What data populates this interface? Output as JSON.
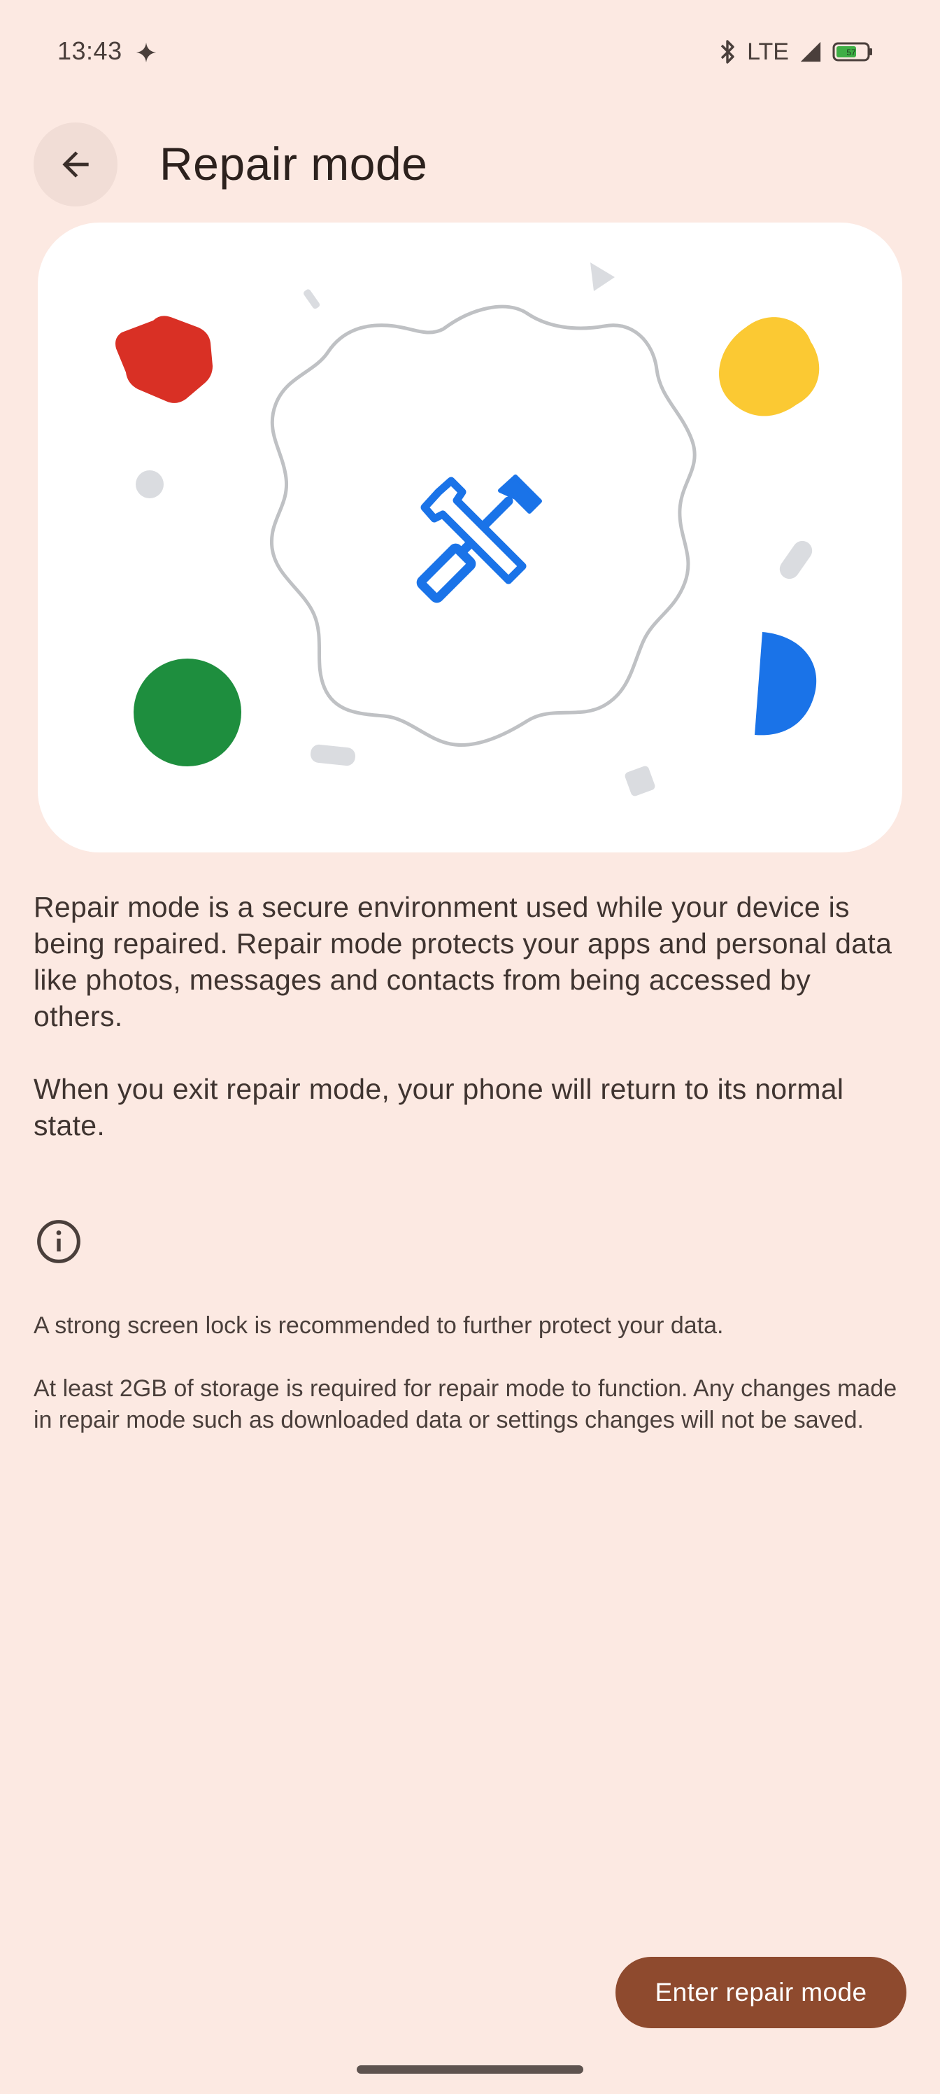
{
  "status_bar": {
    "time": "13:43",
    "network": "LTE",
    "battery_level": "57",
    "icons": [
      "sparkle-icon",
      "bluetooth-icon",
      "signal-icon",
      "battery-icon"
    ]
  },
  "header": {
    "back_icon": "arrow-back-icon",
    "title": "Repair mode"
  },
  "illustration": {
    "center_icon": "repair-tools-icon",
    "accent": "#1a73e8",
    "shape_colors": {
      "red": "#d93025",
      "yellow": "#fbc933",
      "green": "#1e8e3e",
      "blue": "#1a73e8",
      "gray": "#dadce0"
    }
  },
  "content": {
    "paragraph_1": "Repair mode is a secure environment used while your device is being repaired. Repair mode protects your apps and personal data like photos, messages and contacts from being accessed by others.",
    "paragraph_2": "When you exit repair mode, your phone will return to its normal state.",
    "info_icon": "info-icon",
    "note_1": "A strong screen lock is recommended to further protect your data.",
    "note_2": "At least 2GB of storage is required for repair mode to function. Any changes made in repair mode such as downloaded data or settings changes will not be saved."
  },
  "footer": {
    "primary_button": "Enter repair mode",
    "button_color": "#8e4a2e"
  }
}
